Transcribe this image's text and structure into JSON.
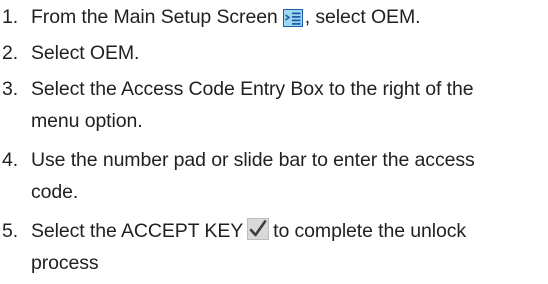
{
  "steps": [
    {
      "number": "1.",
      "before_icon": "From the Main Setup Screen",
      "icon": "main-setup-icon",
      "after_icon": ", select OEM."
    },
    {
      "number": "2.",
      "text": "Select OEM."
    },
    {
      "number": "3.",
      "line1": "Select the Access Code Entry Box to the right of the",
      "line2": "menu option."
    },
    {
      "number": "4.",
      "line1": "Use the number pad or slide bar to enter the access",
      "line2": "code."
    },
    {
      "number": "5.",
      "before_icon": "Select the ACCEPT KEY",
      "icon": "accept-checkmark-icon",
      "after_icon": "to complete the unlock",
      "line2": "process"
    }
  ],
  "colors": {
    "text": "#231f20",
    "icon_fill": "#9fd8f5",
    "icon_stroke": "#1f5fa8",
    "accept_icon_fill": "#d9d9d9",
    "accept_check": "#3f3f3f"
  }
}
